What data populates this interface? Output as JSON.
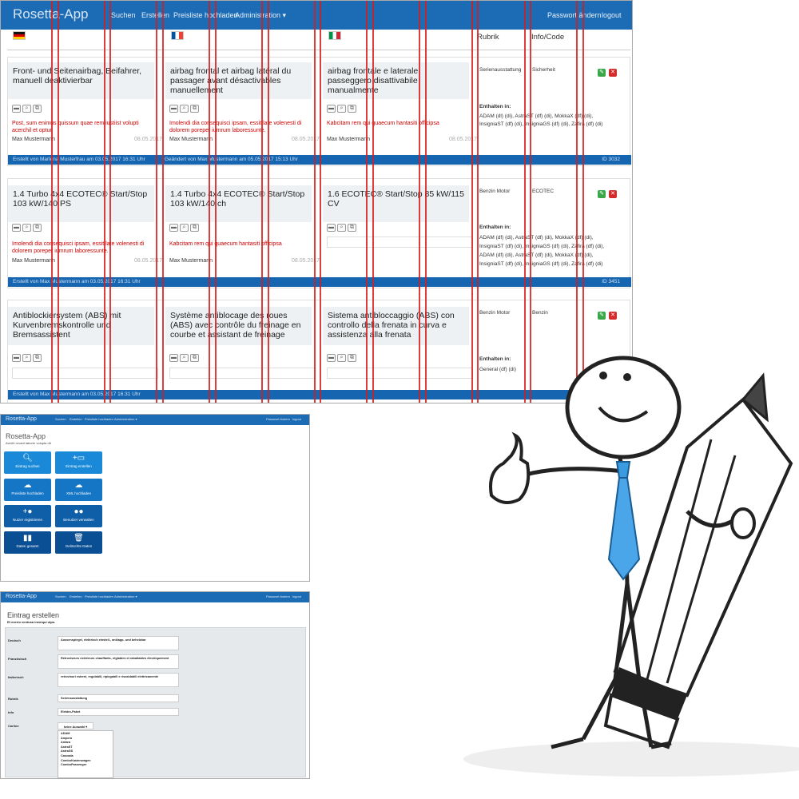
{
  "main": {
    "brand": "Rosetta-App",
    "nav": [
      "Suchen",
      "Erstellen",
      "Preisliste hochladen",
      "Administration ▾"
    ],
    "nav_right": [
      "Passwort ändern",
      "logout"
    ],
    "col_rubrik": "Rubrik",
    "col_info": "Info/Code",
    "rows": [
      {
        "de": "Front- und Seitenairbag, Beifahrer, manuell deaktivierbar",
        "fr": "airbag frontal et airbag latéral du passager avant désactivables manuellement",
        "it": "airbag frontale e laterale passeggero disattivabile manualmente",
        "de_note": "Post, sum enimus quissum quae rem iustiist volupti acerchil et optur.",
        "fr_note": "Imolendi dia consequisci ipsam, essit late volenesti di dolorem poreper iumrum laboressunte.",
        "it_note": "Kabcitam rem qui quaecum hantasiti officipsa",
        "de_user": "Max Mustermann",
        "de_date": "08.05.2017",
        "fr_user": "Max Mustermann",
        "fr_date": "08.05.2017",
        "it_user": "Max Mustermann",
        "it_date": "08.05.2017",
        "rubrik": "Serienausstattung",
        "info": "Sicherheit",
        "enthalten_label": "Enthalten in:",
        "enthalten": [
          "ADAM (dl) (di), AstraST (df) (di), MokkaX (df) (di),",
          "InsigniaST (df) (di), InsigniaGS (df) (di), Zafira (df) (di)"
        ],
        "foot_left": "Erstellt von Marlena Musterfrau am 03.05.2017 16:31 Uhr",
        "foot_mid": "Geändert von Max Mustermann am 05.05.2017 15:13 Uhr",
        "foot_id": "ID 3032"
      },
      {
        "de": "1.4 Turbo 4x4 ECOTEC® Start/Stop 103 kW/140 PS",
        "fr": "1.4 Turbo 4x4 ECOTEC® Start/Stop 103 kW/140 ch",
        "it": "1.6 ECOTEC® Start/Stop 85 kW/115 CV",
        "de_note": "Imolendi dia consequisci ipsam, essit late volenesti di dolorem poreper iumrum laboressunte.",
        "fr_note": "Kabcitam rem qui quaecum hantasiti officipsa",
        "de_user": "Max Mustermann",
        "de_date": "08.05.2017",
        "fr_user": "Max Mustermann",
        "fr_date": "08.05.2017",
        "rubrik": "Benzin Motor",
        "info": "ECOTEC",
        "enthalten_label": "Enthalten in:",
        "enthalten": [
          "ADAM (df) (di), AstraST (df) (di), MokkaX (df) (di),",
          "InsigniaST (df) (di), InsigniaGS (df) (di), Zafira (df) (di),",
          "ADAM (df) (di), AstraST (df) (di), MokkaX (df) (di),",
          "InsigniaST (df) (di), InsigniaGS (df) (di), Zafira (df) (di)"
        ],
        "foot_left": "Erstellt von Max Mustermann am 03.05.2017 16:31 Uhr",
        "foot_id": "ID 3451"
      },
      {
        "de": "Antiblockiersystem (ABS) mit Kurvenbremskontrolle und Bremsassistent",
        "fr": "Système antiblocage des roues (ABS) avec contrôle du freinage en courbe et assistant de freinage",
        "it": "Sistema antibloccaggio (ABS) con controllo della frenata in curva e assistenza alla frenata",
        "rubrik": "Benzin Motor",
        "info": "Benzin",
        "enthalten_label": "Enthalten in:",
        "enthalten": [
          "General (df) (di)"
        ],
        "foot_left": "Erstellt von Max Mustermann am 03.05.2017 16:31 Uhr"
      }
    ]
  },
  "dash": {
    "brand": "Rosetta-App",
    "nav": [
      "Suchen",
      "Erstellen",
      "Preisliste hochladen",
      "Administration ▾"
    ],
    "nav_right": [
      "Passwort ändern",
      "logout"
    ],
    "title": "Rosetta-App",
    "subtitle": "Acerfe rovant laborer volupta dit",
    "tiles": [
      {
        "label": "Eintrag suchen",
        "glyph": "🔍︎"
      },
      {
        "label": "Eintrag erstellen",
        "glyph": "+▭"
      },
      {
        "label": "Preisliste hochladen",
        "glyph": "☁"
      },
      {
        "label": "XML hochladen",
        "glyph": "☁"
      },
      {
        "label": "Nutzer registrieren",
        "glyph": "+●"
      },
      {
        "label": "Benutzer verwalten",
        "glyph": "●●"
      },
      {
        "label": "Daten gesamt",
        "glyph": "▮▮"
      },
      {
        "label": "Gelöschte Daten",
        "glyph": "🗑︎"
      }
    ]
  },
  "form": {
    "brand": "Rosetta-App",
    "nav": [
      "Suchen",
      "Erstellen",
      "Preisliste hochladen",
      "Administration ▾"
    ],
    "nav_right": [
      "Passwort ändern",
      "logout"
    ],
    "title": "Eintrag erstellen",
    "subtitle": "Et exerio ventusa inemqui ulpa.",
    "fields": [
      {
        "label": "Deutsch",
        "value": "Aussenspiegel, elektrisch einstell-, anklapp- und beheizbar"
      },
      {
        "label": "Französisch",
        "value": "Rétroviseurs extérieurs chauffants, réglables et rabattables électriquement"
      },
      {
        "label": "Italienisch",
        "value": "retrovisori esterni, regolabili, ripiegabili e riscaldabili elettricamente"
      },
      {
        "label": "Rubrik",
        "value": "Serienausstattung"
      },
      {
        "label": "Info",
        "value": "Elektro-Paket"
      },
      {
        "label": "Carline",
        "value": "keine Auswahl ▾"
      }
    ],
    "dropdown": [
      "ADAM",
      "Ampera",
      "Antara",
      "AstraST",
      "AstraGS",
      "Cascada",
      "ComboKastenwagen",
      "ComboPassenger"
    ]
  },
  "colors": {
    "nav": "#1c6cb5",
    "footer": "#1565b0",
    "tile": "#1a76c8",
    "grid_line": "#d61c1c"
  }
}
